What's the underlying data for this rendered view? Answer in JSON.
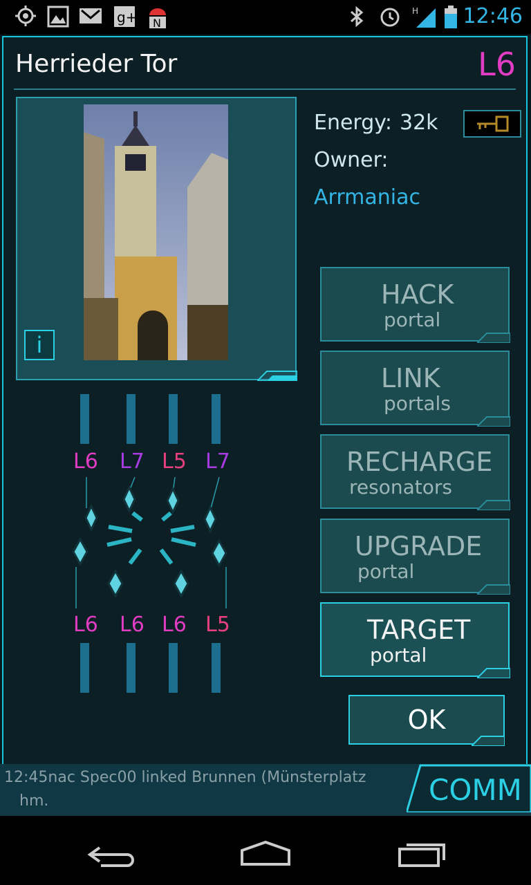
{
  "status_bar": {
    "time": "12:46",
    "icons": [
      "location-icon",
      "image-icon",
      "gmail-icon",
      "google-plus-icon",
      "android-debug-icon",
      "bluetooth-icon",
      "alarm-icon",
      "signal-icon",
      "battery-icon"
    ]
  },
  "portal": {
    "title": "Herrieder Tor",
    "level": "L6",
    "energy_label": "Energy:",
    "energy_value": "32k",
    "owner_label": "Owner:",
    "owner_name": "Arrmaniac",
    "info_label": "i"
  },
  "actions": [
    {
      "big": "HACK",
      "small": "portal"
    },
    {
      "big": "LINK",
      "small": "portals"
    },
    {
      "big": "RECHARGE",
      "small": "resonators"
    },
    {
      "big": "UPGRADE",
      "small": "portal"
    },
    {
      "big": "TARGET",
      "small": "portal"
    }
  ],
  "ok_label": "OK",
  "resonators": {
    "top_levels": [
      "L6",
      "L7",
      "L5",
      "L7"
    ],
    "bottom_levels": [
      "L6",
      "L6",
      "L6",
      "L5"
    ]
  },
  "comm": {
    "label": "COMM",
    "line1": "12:45nac  Spec00 linked Brunnen (Münsterplatz",
    "line2": "hm."
  },
  "colors": {
    "accent": "#2bd0e5",
    "level_magenta": "#e23cc4",
    "level_l7": "#a83ce2",
    "owner_blue": "#33b5e5"
  }
}
